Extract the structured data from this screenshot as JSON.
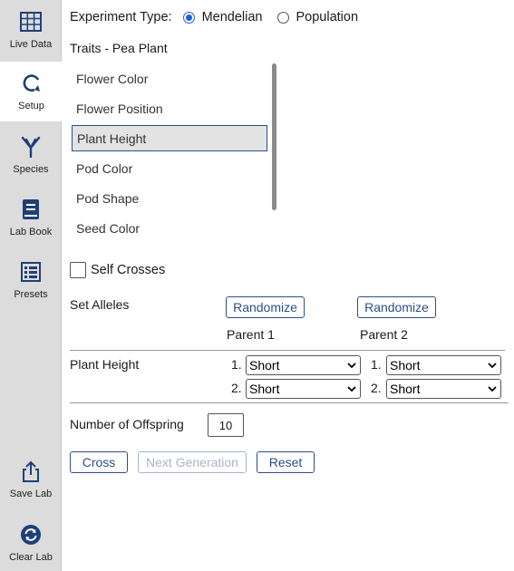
{
  "sidebar": {
    "items": [
      {
        "label": "Live Data",
        "icon": "grid-icon"
      },
      {
        "label": "Setup",
        "icon": "refresh-arrow-icon",
        "active": true
      },
      {
        "label": "Species",
        "icon": "branch-icon"
      },
      {
        "label": "Lab Book",
        "icon": "book-icon"
      },
      {
        "label": "Presets",
        "icon": "list-icon"
      },
      {
        "label": "Save Lab",
        "icon": "share-icon"
      },
      {
        "label": "Clear Lab",
        "icon": "recycle-icon"
      }
    ]
  },
  "experiment": {
    "label": "Experiment Type:",
    "options": [
      "Mendelian",
      "Population"
    ],
    "selected": "Mendelian"
  },
  "traits": {
    "title": "Traits - Pea Plant",
    "items": [
      "Flower Color",
      "Flower Position",
      "Plant Height",
      "Pod Color",
      "Pod Shape",
      "Seed Color"
    ],
    "selected": "Plant Height"
  },
  "self_crosses": {
    "label": "Self Crosses",
    "checked": false
  },
  "alleles": {
    "title": "Set Alleles",
    "randomize_label": "Randomize",
    "parent1_label": "Parent 1",
    "parent2_label": "Parent 2",
    "trait_label": "Plant Height",
    "num1": "1.",
    "num2": "2.",
    "parent1": [
      "Short",
      "Short"
    ],
    "parent2": [
      "Short",
      "Short"
    ]
  },
  "offspring": {
    "label": "Number of Offspring",
    "value": "10"
  },
  "actions": {
    "cross": "Cross",
    "next_generation": "Next Generation",
    "reset": "Reset"
  },
  "colors": {
    "accent": "#2d4e8a",
    "radio": "#1d5fd1",
    "sidebar_bg": "#dcdcdc",
    "icon": "#1f3f78"
  }
}
